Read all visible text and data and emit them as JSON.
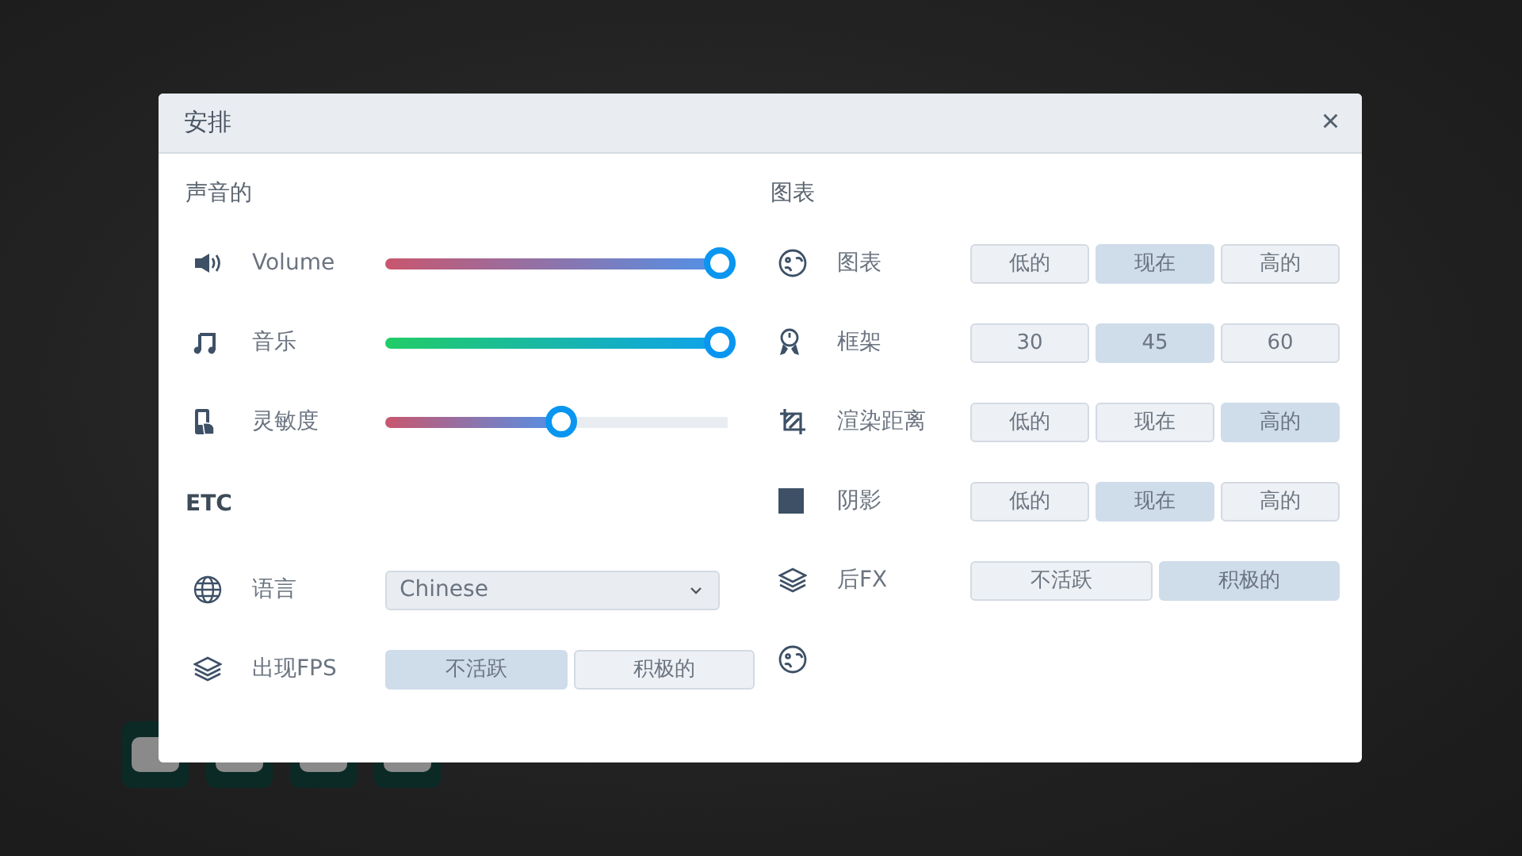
{
  "dialog": {
    "title": "安排",
    "close": "×"
  },
  "sections": [
    {
      "title": "声音的",
      "rows": [
        {
          "kind": "slider",
          "label": "Volume",
          "level": 1.0
        },
        {
          "kind": "slider",
          "label": "音乐",
          "level": 1.0
        },
        {
          "kind": "slider",
          "label": "灵敏度",
          "level": 0.5
        }
      ]
    },
    {
      "title": "ETC",
      "rows": [
        {
          "kind": "select",
          "label": "语言",
          "value": "Chinese"
        },
        {
          "kind": "segmented",
          "label": "出现FPS",
          "options": [
            {
              "label": "不活跃",
              "selected": true
            },
            {
              "label": "积极的",
              "selected": false
            }
          ]
        }
      ]
    },
    {
      "title": "图表",
      "rows": [
        {
          "kind": "segmented",
          "label": "图表",
          "options": [
            {
              "label": "低的",
              "selected": false
            },
            {
              "label": "现在",
              "selected": true
            },
            {
              "label": "高的",
              "selected": false
            }
          ]
        },
        {
          "kind": "segmented",
          "label": "框架",
          "options": [
            {
              "label": "30",
              "selected": false
            },
            {
              "label": "45",
              "selected": true
            },
            {
              "label": "60",
              "selected": false
            }
          ]
        },
        {
          "kind": "segmented",
          "label": "渲染距离",
          "options": [
            {
              "label": "低的",
              "selected": false
            },
            {
              "label": "现在",
              "selected": false
            },
            {
              "label": "高的",
              "selected": true
            }
          ]
        },
        {
          "kind": "segmented",
          "label": "阴影",
          "options": [
            {
              "label": "低的",
              "selected": false
            },
            {
              "label": "现在",
              "selected": true
            },
            {
              "label": "高的",
              "selected": false
            }
          ]
        },
        {
          "kind": "segmented",
          "label": "后FX",
          "options": [
            {
              "label": "不活跃",
              "selected": false
            },
            {
              "label": "积极的",
              "selected": true
            }
          ]
        },
        {
          "kind": "icon-only"
        }
      ]
    }
  ]
}
